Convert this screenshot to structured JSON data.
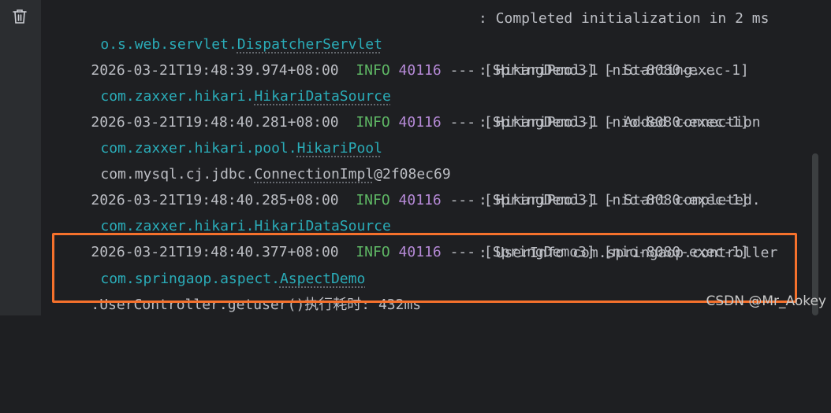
{
  "console": {
    "lines": [
      {
        "logger_pkg": "o.s.web.servlet.",
        "logger_cls": "DispatcherServlet",
        "message": ": Completed initialization in 2 ms"
      },
      {
        "timestamp": "2026-03-21T19:48:39.974+08:00",
        "level": "INFO",
        "pid": "40116",
        "rest": "--- [SpringDemo3] [nio-8080-exec-1]"
      },
      {
        "logger_pkg": "com.zaxxer.hikari.",
        "logger_cls": "HikariDataSource",
        "message": ": HikariPool-1 - Starting..."
      },
      {
        "timestamp": "2026-03-21T19:48:40.281+08:00",
        "level": "INFO",
        "pid": "40116",
        "rest": "--- [SpringDemo3] [nio-8080-exec-1]"
      },
      {
        "logger_pkg": "com.zaxxer.hikari.pool.",
        "logger_cls": "HikariPool",
        "message": ": HikariPool-1 - Added connection"
      },
      {
        "text_pre": "com.mysql.cj.jdbc.",
        "text_cls": "ConnectionImpl",
        "text_post": "@2f08ec69"
      },
      {
        "timestamp": "2026-03-21T19:48:40.285+08:00",
        "level": "INFO",
        "pid": "40116",
        "rest": "--- [SpringDemo3] [nio-8080-exec-1]"
      },
      {
        "logger_pkg": "com.zaxxer.hikari.",
        "logger_cls": "HikariDataSource",
        "message": ": HikariPool-1 - Start completed."
      },
      {
        "timestamp": "2026-03-21T19:48:40.377+08:00",
        "level": "INFO",
        "pid": "40116",
        "rest": "--- [SpringDemo3] [nio-8080-exec-1]"
      },
      {
        "logger_pkg": "com.springaop.aspect.",
        "logger_cls": "AspectDemo",
        "message": ": UserInfo com.springaop.controller"
      },
      {
        "text": ".UserController.getuser()执行耗时: 432ms"
      }
    ]
  },
  "toolbar": {
    "clear_icon": "trash-icon"
  },
  "highlight_color": "#f5712c",
  "watermark": "CSDN @Mr_Aokey"
}
